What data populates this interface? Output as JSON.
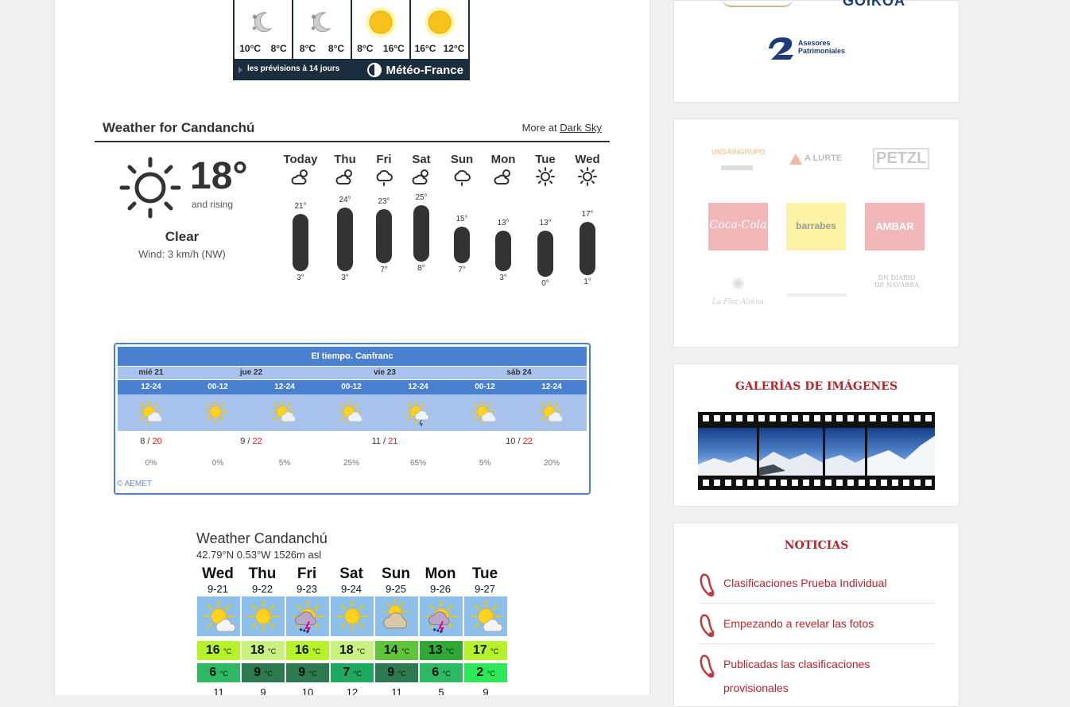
{
  "meteofrance": {
    "cells": [
      {
        "icon": "moon-clouds-icon",
        "min": "10°C",
        "max": "8°C"
      },
      {
        "icon": "moon-clouds-icon",
        "min": "8°C",
        "max": "8°C"
      },
      {
        "icon": "sun-icon",
        "min": "8°C",
        "max": "16°C"
      },
      {
        "icon": "sun-icon",
        "min": "16°C",
        "max": "12°C"
      }
    ],
    "link": "les prévisions à 14 jours",
    "brand": "Météo-France"
  },
  "darksky": {
    "title": "Weather for Candanchú",
    "more_prefix": "More at",
    "more_link": "Dark Sky",
    "current_temp": "18°",
    "rising": "and rising",
    "summary": "Clear",
    "wind": "Wind: 3 km/h (NW)",
    "days": [
      {
        "name": "Today",
        "icon": "partly-cloudy-icon",
        "hi": "21°",
        "lo": "3°",
        "high": 21,
        "low": 3
      },
      {
        "name": "Thu",
        "icon": "partly-cloudy-icon",
        "hi": "24°",
        "lo": "3°",
        "high": 24,
        "low": 3
      },
      {
        "name": "Fri",
        "icon": "rain-icon",
        "hi": "23°",
        "lo": "7°",
        "high": 23,
        "low": 7
      },
      {
        "name": "Sat",
        "icon": "partly-cloudy-icon",
        "hi": "25°",
        "lo": "8°",
        "high": 25,
        "low": 8
      },
      {
        "name": "Sun",
        "icon": "rain-icon",
        "hi": "15°",
        "lo": "7°",
        "high": 15,
        "low": 7
      },
      {
        "name": "Mon",
        "icon": "partly-cloudy-icon",
        "hi": "13°",
        "lo": "3°",
        "high": 13,
        "low": 3
      },
      {
        "name": "Tue",
        "icon": "sun-icon",
        "hi": "13°",
        "lo": "0°",
        "high": 13,
        "low": 0
      },
      {
        "name": "Wed",
        "icon": "sun-icon",
        "hi": "17°",
        "lo": "1°",
        "high": 17,
        "low": 1
      }
    ]
  },
  "aemet": {
    "title": "El tiempo. Canfranc",
    "days": [
      "mié 21",
      "jue 22",
      "vie 23",
      "sáb 24"
    ],
    "periods": [
      "12-24",
      "00-12",
      "12-24",
      "00-12",
      "12-24",
      "00-12",
      "12-24"
    ],
    "icons": [
      "sun-cloud-icon",
      "sun-icon",
      "sun-cloud-icon",
      "sun-cloud-icon",
      "sun-storm-icon",
      "sun-cloud-icon",
      "sun-cloud-icon"
    ],
    "temps": [
      {
        "min": "8",
        "max": "20"
      },
      {
        "min": "9",
        "max": "22"
      },
      {
        "min": "11",
        "max": "21"
      },
      {
        "min": "10",
        "max": "22"
      }
    ],
    "precip": [
      "0%",
      "0%",
      "5%",
      "25%",
      "65%",
      "5%",
      "20%"
    ],
    "copyright": "© AEMET"
  },
  "meteoblue": {
    "title": "Weather Candanchú",
    "coords": "42.79°N 0.53°W 1526m asl",
    "unit": "°C",
    "days": [
      {
        "day": "Wed",
        "date": "9-21",
        "icon": "sun-cloud-icon",
        "hi": "16",
        "lo": "6",
        "wind": "11",
        "hi_color": "#b6f22a",
        "lo_color": "#2fb864"
      },
      {
        "day": "Thu",
        "date": "9-22",
        "icon": "sun-icon",
        "hi": "18",
        "lo": "9",
        "wind": "9",
        "hi_color": "#c9f080",
        "lo_color": "#2e7a50"
      },
      {
        "day": "Fri",
        "date": "9-23",
        "icon": "storm-icon",
        "hi": "16",
        "lo": "9",
        "wind": "10",
        "hi_color": "#b6f22a",
        "lo_color": "#2e7a50"
      },
      {
        "day": "Sat",
        "date": "9-24",
        "icon": "sun-icon",
        "hi": "18",
        "lo": "7",
        "wind": "12",
        "hi_color": "#c9f080",
        "lo_color": "#1fa860"
      },
      {
        "day": "Sun",
        "date": "9-25",
        "icon": "cloud-sun-icon",
        "hi": "14",
        "lo": "9",
        "wind": "11",
        "hi_color": "#5fc43a",
        "lo_color": "#2e7a50"
      },
      {
        "day": "Mon",
        "date": "9-26",
        "icon": "storm-icon",
        "hi": "13",
        "lo": "6",
        "wind": "5",
        "hi_color": "#2fa836",
        "lo_color": "#2fb864"
      },
      {
        "day": "Tue",
        "date": "9-27",
        "icon": "sun-cloud-icon",
        "hi": "17",
        "lo": "2",
        "wind": "9",
        "hi_color": "#b6f22a",
        "lo_color": "#2ee85a"
      }
    ]
  },
  "sidebar": {
    "logos_top": [
      "GOIKOA",
      "Asesores Patrimoniales"
    ],
    "sponsors": [
      "UNSAINGRUPO",
      "A LURTE",
      "PETZL",
      "Coca-Cola",
      "barrabes",
      "AMBAR",
      "La Flor Alpina",
      "",
      "DN DIARIO DE NAVARRA"
    ],
    "gallery_title": "GALERÍAS DE IMÁGENES",
    "news_title": "NOTICIAS",
    "news": [
      "Clasificaciones Prueba Individual",
      "Empezando a revelar las fotos",
      "Publicadas las clasificaciones",
      "provisionales"
    ]
  },
  "colors": {
    "accent_red": "#b3282d",
    "aemet_blue": "#4a80d0",
    "aemet_light": "#a8c2ee",
    "meteofrance_bg": "#1c2d3d"
  }
}
